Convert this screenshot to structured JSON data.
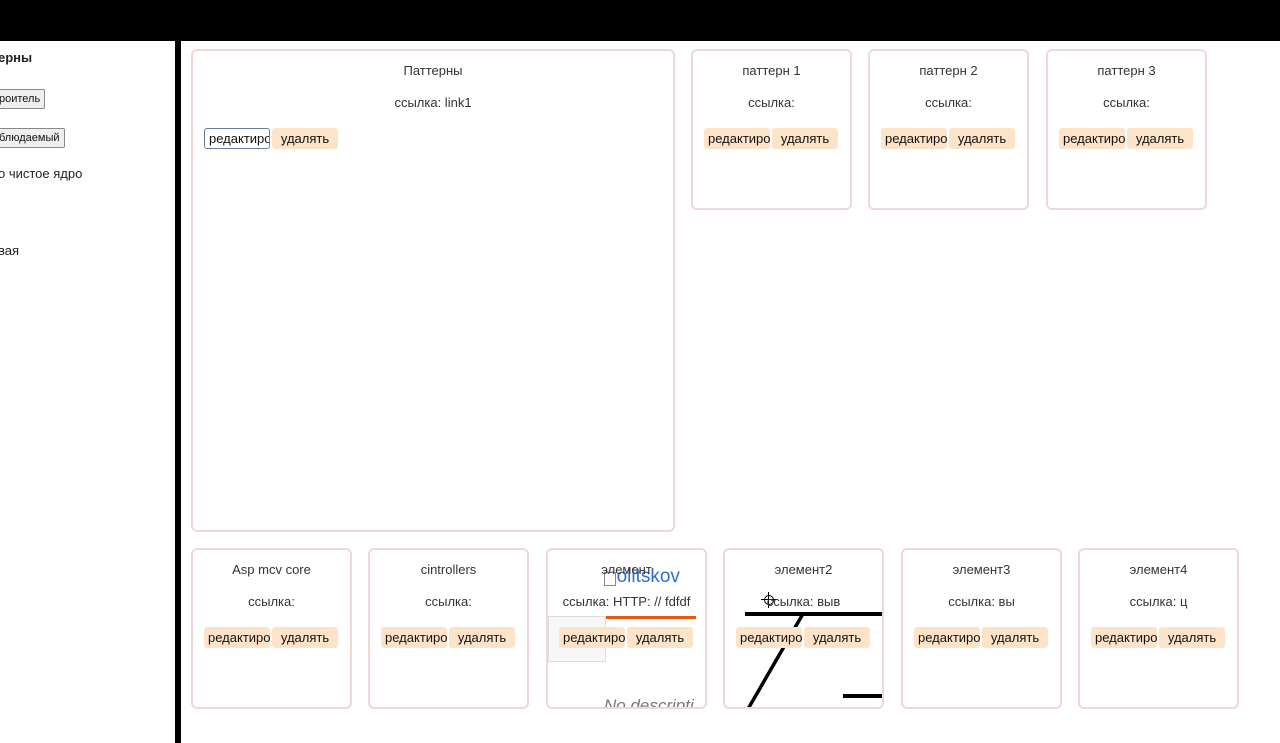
{
  "sidebar": {
    "title": "ерны",
    "buttons": [
      "роитель",
      "блюдаемый"
    ],
    "texts": [
      "о чистое ядро",
      "вая"
    ]
  },
  "cards": [
    {
      "title": "Паттерны",
      "link": "ссылка: link1",
      "edit": "редактировать",
      "delete": "удалять"
    },
    {
      "title": "паттерн 1",
      "link": "ссылка:",
      "edit": "редактировать",
      "delete": "удалять"
    },
    {
      "title": "паттерн 2",
      "link": "ссылка:",
      "edit": "редактировать",
      "delete": "удалять"
    },
    {
      "title": "паттерн 3",
      "link": "ссылка:",
      "edit": "редактировать",
      "delete": "удалять"
    },
    {
      "title": "Asp mcv core",
      "link": "ссылка:",
      "edit": "редактировать",
      "delete": "удалять"
    },
    {
      "title": "cintrollers",
      "link": "ссылка:",
      "edit": "редактировать",
      "delete": "удалять"
    },
    {
      "title": "элемент",
      "link": "ссылка: HTTP: // fdfdf",
      "edit": "редактировать",
      "delete": "удалять"
    },
    {
      "title": "элемент2",
      "link": "ссылка: выв",
      "edit": "редактировать",
      "delete": "удалять"
    },
    {
      "title": "элемент3",
      "link": "ссылка: вы",
      "edit": "редактировать",
      "delete": "удалять"
    },
    {
      "title": "элемент4",
      "link": "ссылка: ц",
      "edit": "редактировать",
      "delete": "удалять"
    }
  ],
  "preview": {
    "site": "politskov",
    "description": "No descripti"
  }
}
